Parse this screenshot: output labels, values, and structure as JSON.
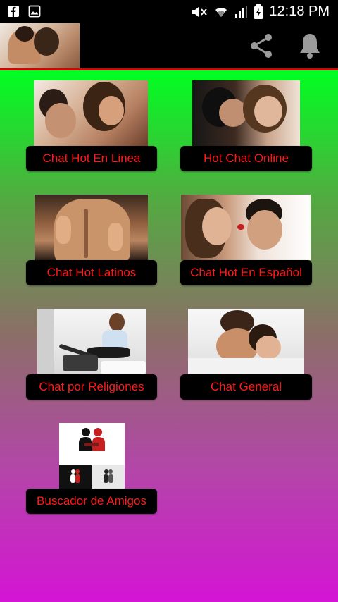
{
  "status_bar": {
    "time": "12:18 PM",
    "left_icons": [
      "facebook-icon",
      "gallery-icon"
    ],
    "right_icons": [
      "mute-icon",
      "wifi-icon",
      "signal-icon",
      "battery-icon"
    ]
  },
  "app_bar": {
    "actions": [
      "share-icon",
      "bell-icon"
    ],
    "accent_color": "#dd0000"
  },
  "tiles": [
    {
      "label": "Chat Hot En Linea"
    },
    {
      "label": "Hot Chat Online"
    },
    {
      "label": "Chat Hot Latinos"
    },
    {
      "label": "Chat Hot En Español"
    },
    {
      "label": "Chat por Religiones"
    },
    {
      "label": "Chat General"
    },
    {
      "label": "Buscador de Amigos"
    }
  ],
  "colors": {
    "gradient_top": "#00ff22",
    "gradient_bottom": "#d414d4",
    "button_bg": "#000000",
    "button_text": "#ff1a1a"
  }
}
